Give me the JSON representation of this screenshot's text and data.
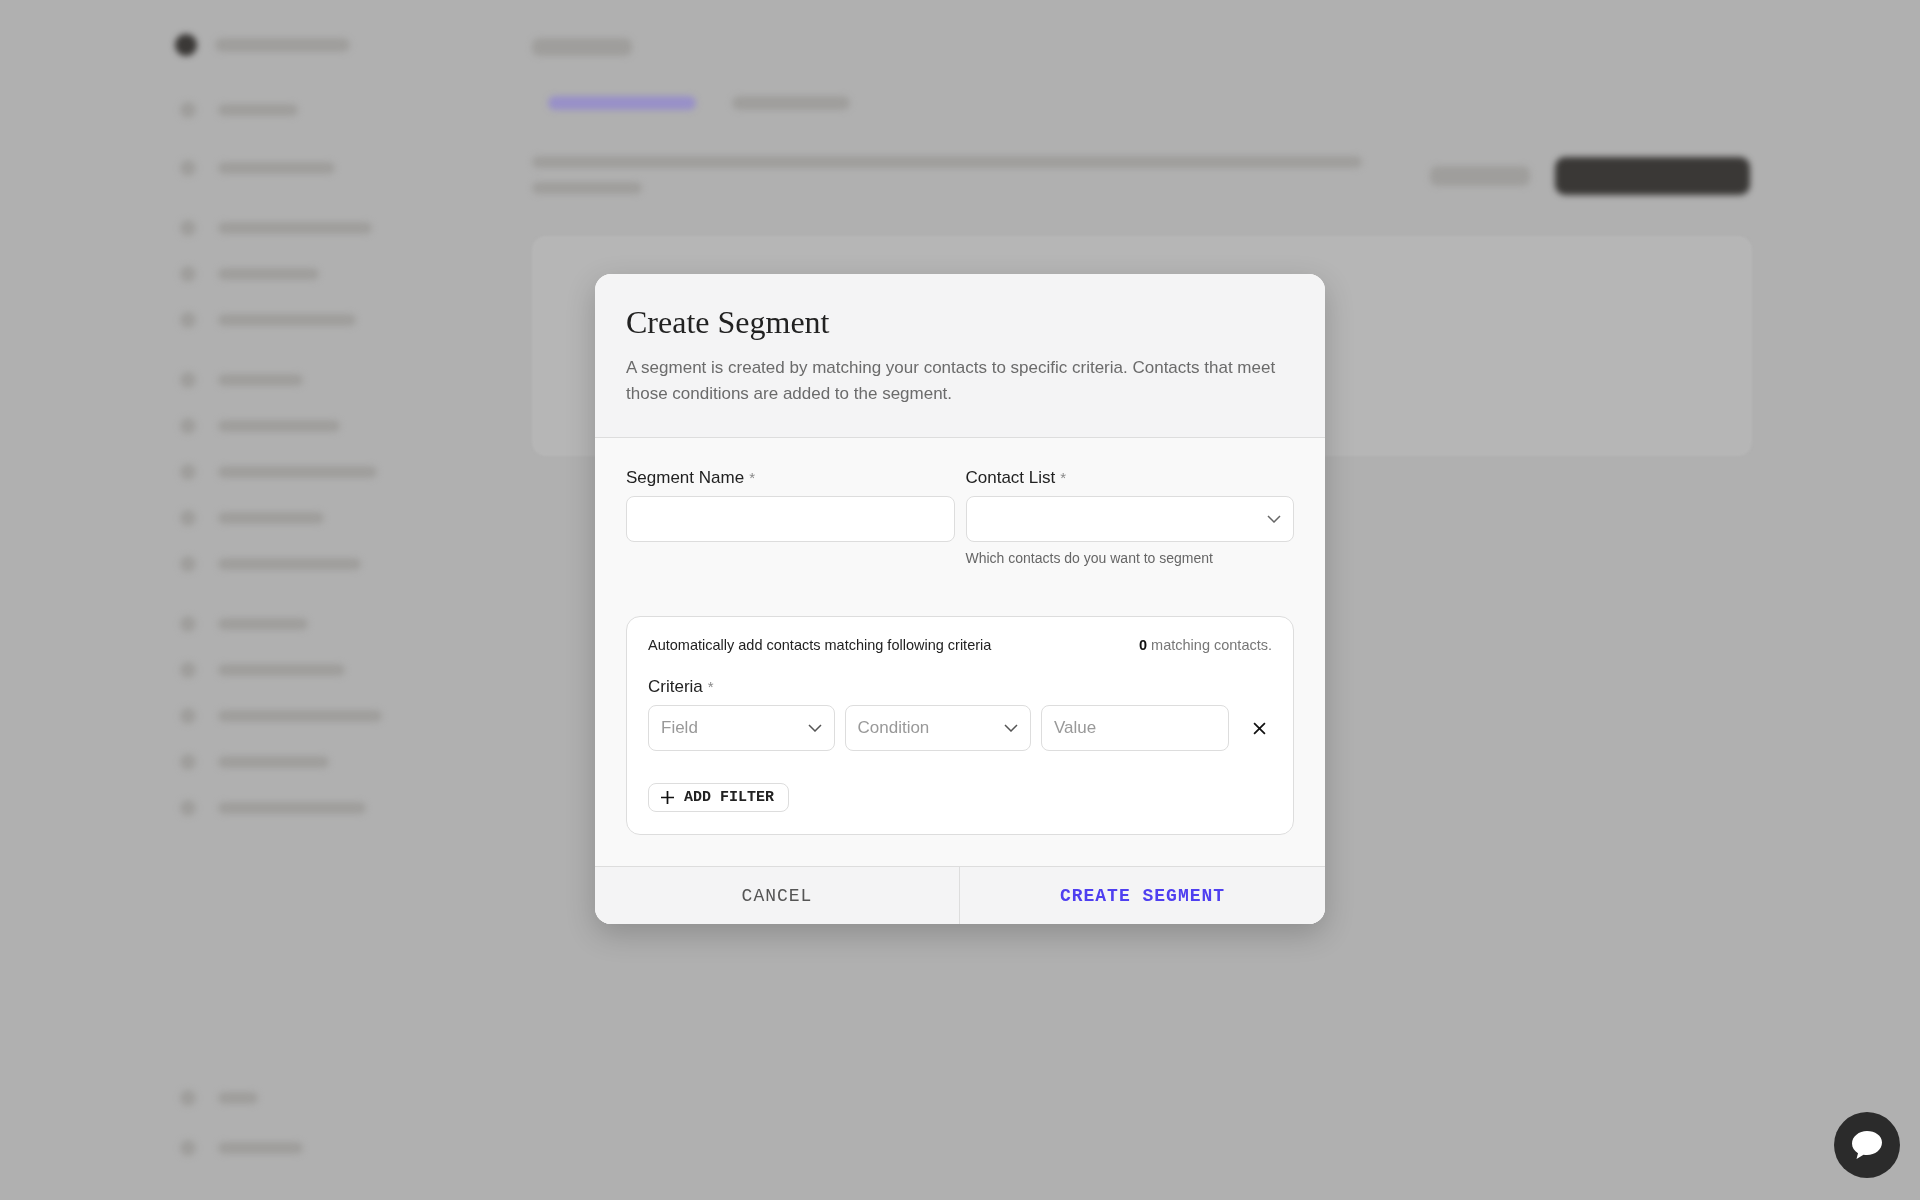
{
  "dialog": {
    "title": "Create Segment",
    "description": "A segment is created by matching your contacts to specific criteria. Contacts that meet those conditions are added to the segment.",
    "fields": [
      {
        "kind": "text",
        "label": "Segment Name",
        "required_mark": "*"
      },
      {
        "kind": "select",
        "label": "Contact List",
        "required_mark": "*",
        "hint": "Which contacts do you want to segment"
      }
    ],
    "criteria_panel": {
      "intro": "Automatically add contacts matching following criteria",
      "match_count": "0",
      "match_suffix": "matching contacts.",
      "label": "Criteria",
      "required_mark": "*",
      "filters": [
        {
          "field": {
            "placeholder": "Field"
          },
          "condition": {
            "placeholder": "Condition"
          },
          "value": {
            "placeholder": "Value"
          }
        }
      ],
      "add_filter": "ADD FILTER"
    },
    "buttons": [
      {
        "label": "CANCEL",
        "kind": "secondary"
      },
      {
        "label": "CREATE SEGMENT",
        "kind": "primary"
      }
    ]
  }
}
